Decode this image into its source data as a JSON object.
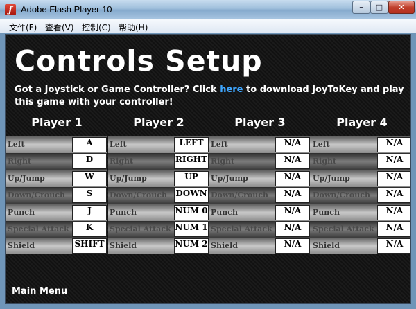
{
  "window": {
    "title": "Adobe Flash Player 10"
  },
  "menu": [
    "文件(F)",
    "查看(V)",
    "控制(C)",
    "帮助(H)"
  ],
  "game": {
    "title": "Controls Setup",
    "info_before": "Got a Joystick or Game Controller? Click ",
    "info_link": "here",
    "info_after": " to download JoyToKey and play this game with your controller!",
    "main_menu": "Main Menu"
  },
  "actions": [
    "Left",
    "Right",
    "Up/Jump",
    "Down/Crouch",
    "Punch",
    "Special Attack",
    "Shield"
  ],
  "players": [
    {
      "name": "Player 1",
      "keys": [
        "A",
        "D",
        "W",
        "S",
        "J",
        "K",
        "SHIFT"
      ]
    },
    {
      "name": "Player 2",
      "keys": [
        "LEFT",
        "RIGHT",
        "UP",
        "DOWN",
        "NUM 0",
        "NUM 1",
        "NUM 2"
      ]
    },
    {
      "name": "Player 3",
      "keys": [
        "N/A",
        "N/A",
        "N/A",
        "N/A",
        "N/A",
        "N/A",
        "N/A"
      ]
    },
    {
      "name": "Player 4",
      "keys": [
        "N/A",
        "N/A",
        "N/A",
        "N/A",
        "N/A",
        "N/A",
        "N/A"
      ]
    }
  ]
}
